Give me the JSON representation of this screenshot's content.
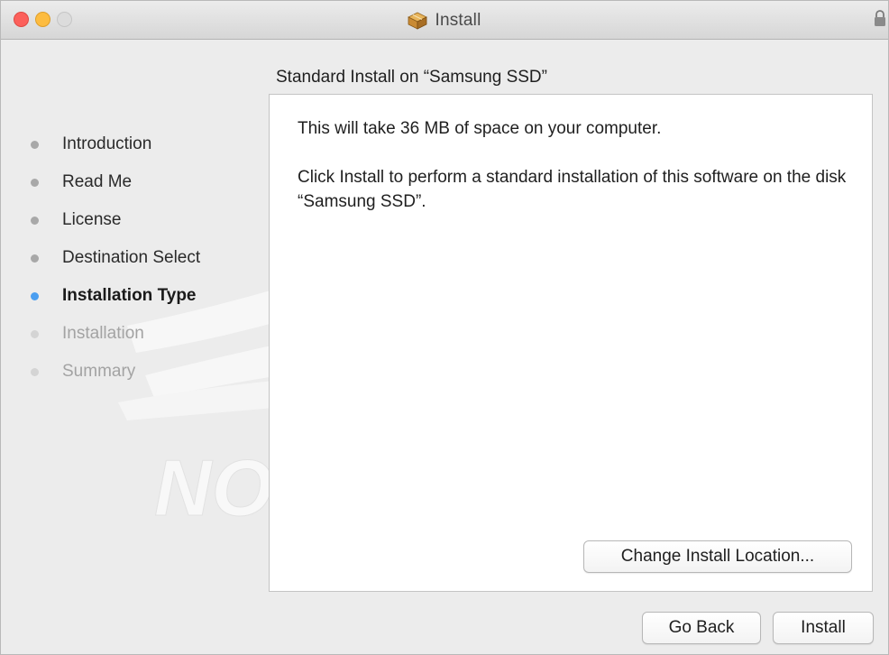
{
  "window": {
    "title": "Install",
    "title_icon": "package-icon",
    "lock_icon": "lock-icon"
  },
  "sidebar": {
    "steps": [
      {
        "label": "Introduction",
        "state": "completed"
      },
      {
        "label": "Read Me",
        "state": "completed"
      },
      {
        "label": "License",
        "state": "completed"
      },
      {
        "label": "Destination Select",
        "state": "completed"
      },
      {
        "label": "Installation Type",
        "state": "current"
      },
      {
        "label": "Installation",
        "state": "pending"
      },
      {
        "label": "Summary",
        "state": "pending"
      }
    ],
    "watermark_text": "NOW"
  },
  "main": {
    "heading": "Standard Install on “Samsung SSD”",
    "paragraph1": "This will take 36 MB of space on your computer.",
    "paragraph2": "Click Install to perform a standard installation of this software on the disk “Samsung SSD”.",
    "change_location_label": "Change Install Location..."
  },
  "footer": {
    "back_label": "Go Back",
    "install_label": "Install"
  },
  "colors": {
    "active_dot": "#4a9ef0",
    "close_button": "#fc605b",
    "minimize_button": "#fdbc40",
    "zoom_button": "#dcdcdc"
  }
}
